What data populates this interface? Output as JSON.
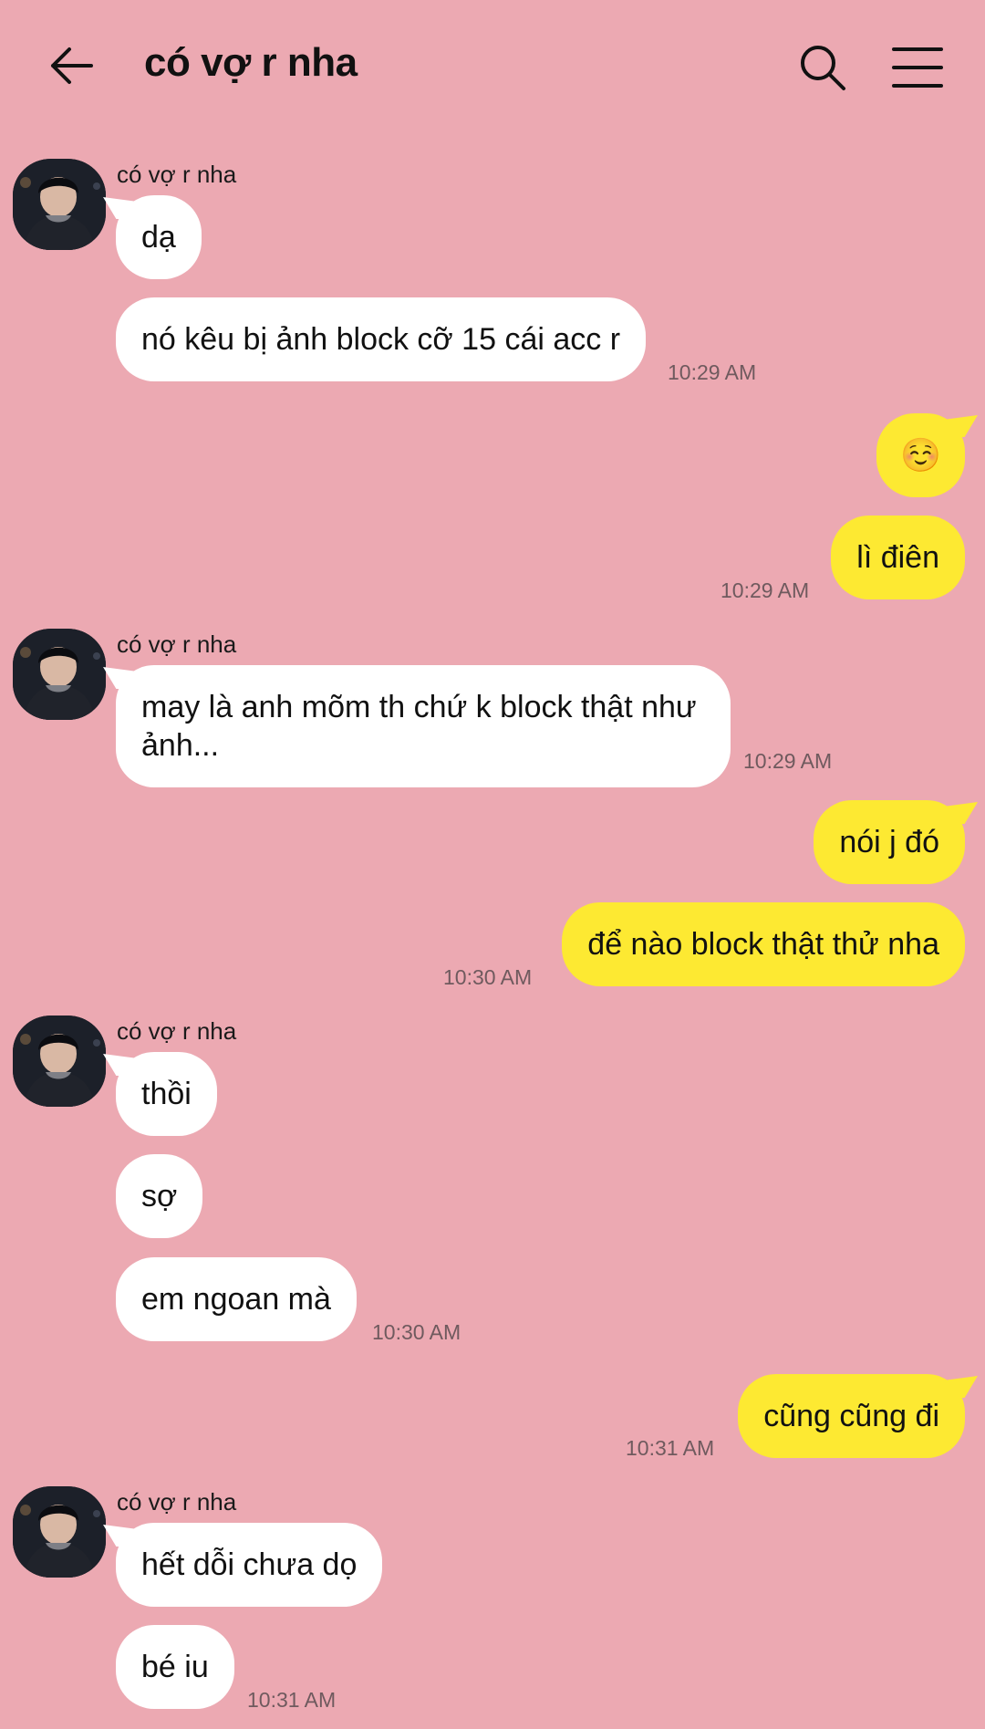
{
  "header": {
    "title": "có vợ r nha"
  },
  "contact": {
    "name": "có vợ r nha"
  },
  "messages": {
    "m1": "dạ",
    "m2": "nó kêu bị ảnh block cỡ 15 cái acc r",
    "t1": "10:29 AM",
    "m3": "☺️",
    "m4": "lì điên",
    "t2": "10:29 AM",
    "m5": "may là anh mõm th chứ k block thật như ảnh...",
    "t3": "10:29 AM",
    "m6": "nói j đó",
    "m7": "để nào block thật thử nha",
    "t4": "10:30 AM",
    "m8": "thồi",
    "m9": "sợ",
    "m10": "em ngoan mà",
    "t5": "10:30 AM",
    "m11": "cũng cũng đi",
    "t6": "10:31 AM",
    "m12": "hết dỗi chưa dọ",
    "m13": "bé iu",
    "t7": "10:31 AM"
  },
  "icons": {
    "back": "arrow-left-icon",
    "search": "search-icon",
    "menu": "menu-icon"
  },
  "colors": {
    "background": "#eca9b2",
    "incoming_bubble": "#ffffff",
    "outgoing_bubble": "#fde932"
  }
}
